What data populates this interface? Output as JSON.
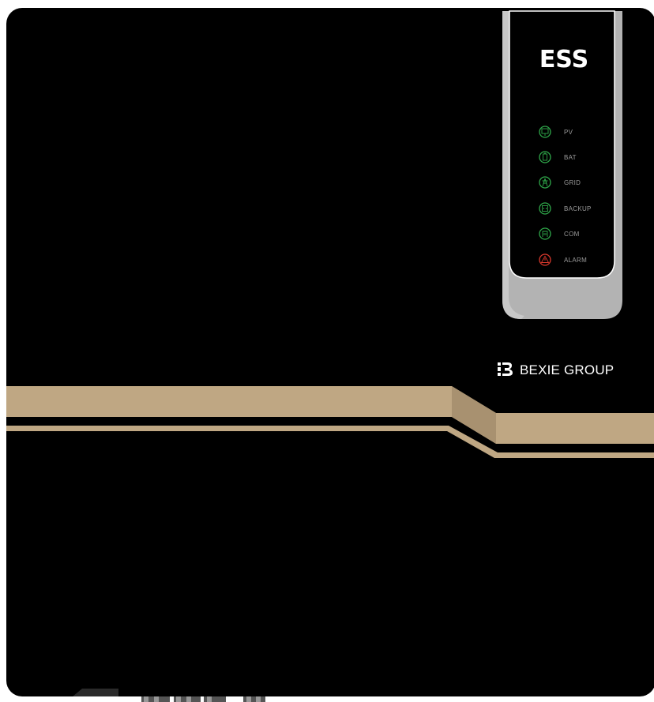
{
  "device": {
    "title": "ESS",
    "brand": "BEXIE GROUP",
    "body_color": "#000000",
    "stripe_color": "#bfa783",
    "bezel_color": "#b3b3b3",
    "leds": [
      {
        "label": "PV",
        "icon": "solar-panel-icon",
        "color": "#2fa84a",
        "status": "normal"
      },
      {
        "label": "BAT",
        "icon": "battery-icon",
        "color": "#2fa84a",
        "status": "normal"
      },
      {
        "label": "GRID",
        "icon": "grid-tower-icon",
        "color": "#2fa84a",
        "status": "normal"
      },
      {
        "label": "BACKUP",
        "icon": "backup-socket-icon",
        "color": "#2fa84a",
        "status": "normal"
      },
      {
        "label": "COM",
        "icon": "communication-icon",
        "color": "#2fa84a",
        "status": "normal"
      },
      {
        "label": "ALARM",
        "icon": "warning-triangle-icon",
        "color": "#d9382c",
        "status": "alarm"
      }
    ]
  }
}
